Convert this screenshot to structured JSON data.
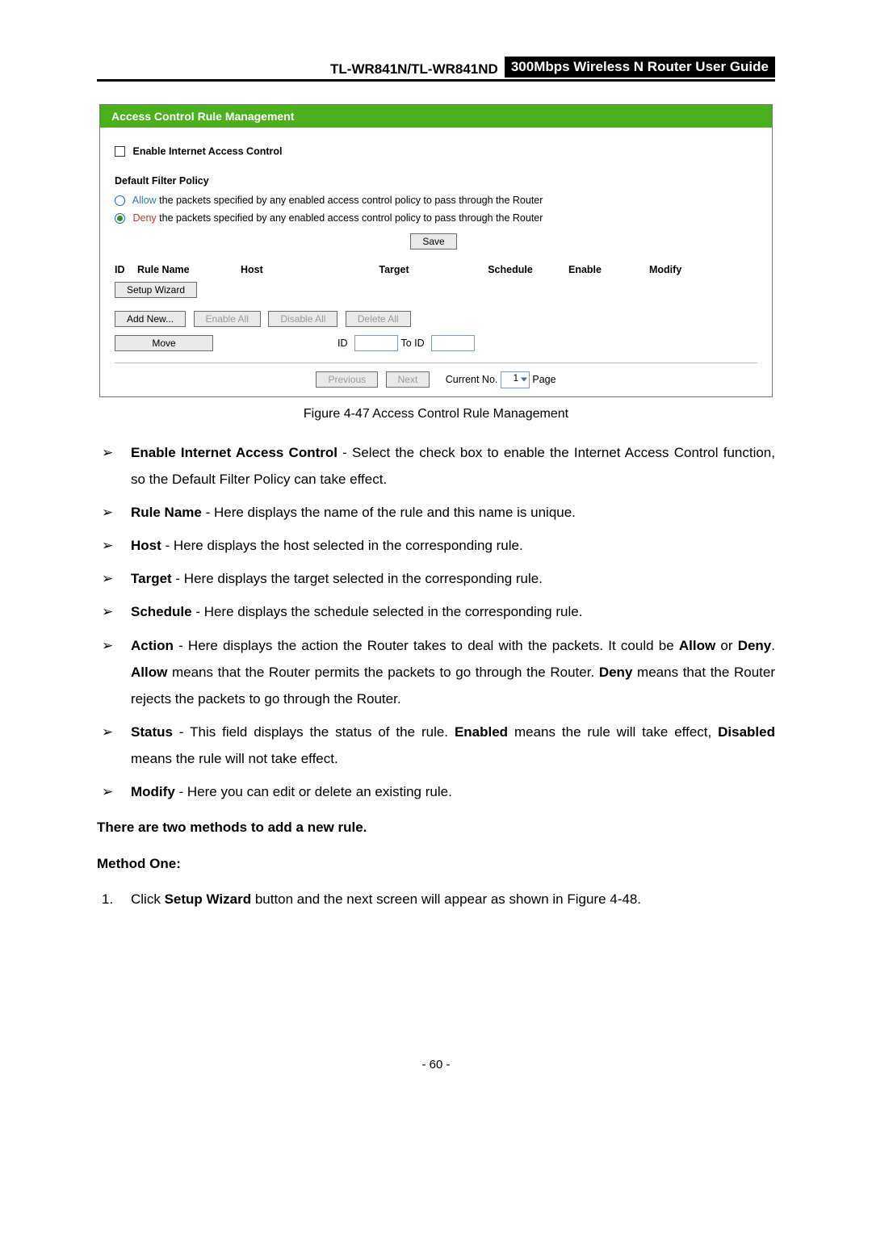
{
  "header": {
    "model": "TL-WR841N/TL-WR841ND",
    "title_right": "300Mbps Wireless N Router User Guide"
  },
  "ui": {
    "title": "Access Control Rule Management",
    "enable_checkbox_label": "Enable Internet Access Control",
    "section_title": "Default Filter Policy",
    "radio_allow_prefix": "Allow",
    "radio_allow_rest": " the packets specified by any enabled access control policy to pass through the Router",
    "radio_deny_prefix": "Deny",
    "radio_deny_rest": " the packets specified by any enabled access control policy to pass through the Router",
    "save": "Save",
    "headers": {
      "id": "ID",
      "rule": "Rule Name",
      "host": "Host",
      "target": "Target",
      "schedule": "Schedule",
      "enable": "Enable",
      "modify": "Modify"
    },
    "btn_setup": "Setup Wizard",
    "btn_add": "Add New...",
    "btn_enable_all": "Enable All",
    "btn_disable_all": "Disable All",
    "btn_delete_all": "Delete All",
    "btn_move": "Move",
    "lbl_id": "ID",
    "lbl_to_id": "To ID",
    "btn_prev": "Previous",
    "btn_next": "Next",
    "lbl_current": "Current No.",
    "page_sel": "1",
    "lbl_page": "Page"
  },
  "caption": "Figure 4-47    Access Control Rule Management",
  "items": [
    {
      "b": "Enable Internet Access Control",
      "t": " - Select the check box to enable the Internet Access Control function, so the Default Filter Policy can take effect."
    },
    {
      "b": "Rule Name",
      "t": " - Here displays the name of the rule and this name is unique."
    },
    {
      "b": "Host",
      "t": " - Here displays the host selected in the corresponding rule."
    },
    {
      "b": "Target",
      "t": " - Here displays the target selected in the corresponding rule."
    },
    {
      "b": "Schedule",
      "t": " - Here displays the schedule selected in the corresponding rule."
    }
  ],
  "action_item": {
    "b1": "Action",
    "t1": " - Here displays the action the Router takes to deal with the packets. It could be ",
    "b2": "Allow",
    "t2": " or ",
    "b3": "Deny",
    "t3": ". ",
    "b4": "Allow",
    "t4": " means that the Router permits the packets to go through the Router. ",
    "b5": "Deny",
    "t5": " means that the Router rejects the packets to go through the Router."
  },
  "status_item": {
    "b1": "Status",
    "t1": " - This field displays the status of the rule. ",
    "b2": "Enabled",
    "t2": " means the rule will take effect, ",
    "b3": "Disabled",
    "t3": " means the rule will not take effect."
  },
  "modify_item": {
    "b": "Modify",
    "t": " - Here you can edit or delete an existing rule."
  },
  "methods_intro": "There are two methods to add a new rule.",
  "method_one_label": "Method One:",
  "step1": {
    "num": "1.",
    "t1": "Click ",
    "b": "Setup Wizard",
    "t2": " button and the next screen will appear as shown in Figure 4-48."
  },
  "page_number": "- 60 -"
}
